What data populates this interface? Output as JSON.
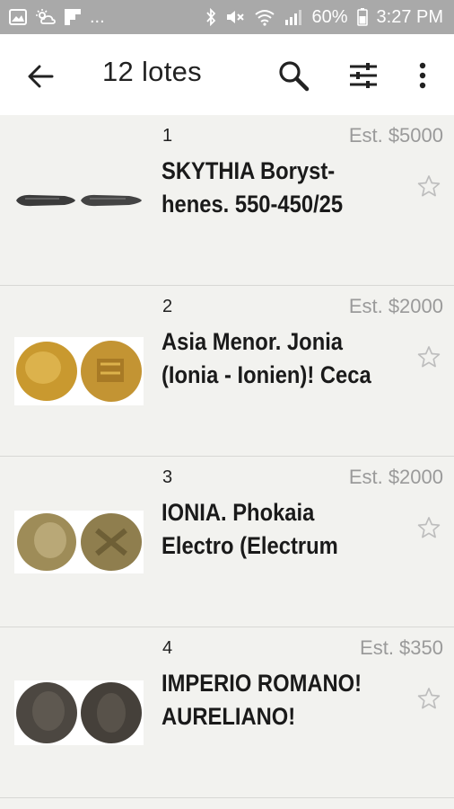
{
  "status_bar": {
    "left_icons": [
      "image-icon",
      "weather-icon",
      "flipboard-icon"
    ],
    "more": "...",
    "battery_pct": "60%",
    "time": "3:27 PM"
  },
  "app_bar": {
    "title": "12 lotes",
    "icons": [
      "back-arrow-icon",
      "search-icon",
      "filter-icon",
      "more-vert-icon"
    ]
  },
  "lots": [
    {
      "number": "1",
      "estimate": "Est. $5000",
      "title": "SKYTHIA Boryst-\nhenes. 550-450/25",
      "coin_color": "#3a3a3a",
      "coin_shape": "arrowhead",
      "starred": false
    },
    {
      "number": "2",
      "estimate": "Est. $2000",
      "title": "Asia Menor. Jonia\n(Ionia - Ionien)! Ceca",
      "coin_color": "#c89a3a",
      "coin_shape": "round",
      "starred": false
    },
    {
      "number": "3",
      "estimate": "Est. $2000",
      "title": "IONIA. Phokaia\nElectro (Electrum",
      "coin_color": "#9c8a5a",
      "coin_shape": "round",
      "starred": false
    },
    {
      "number": "4",
      "estimate": "Est. $350",
      "title": "IMPERIO ROMANO!\nAURELIANO!",
      "coin_color": "#4a4540",
      "coin_shape": "round",
      "starred": false
    }
  ],
  "colors": {
    "status_bar": "#a9a9a9",
    "app_bar": "#ffffff",
    "list_bg": "#f2f2ef",
    "estimate_text": "#9a9a9a",
    "star_outline": "#bdbdbd"
  }
}
